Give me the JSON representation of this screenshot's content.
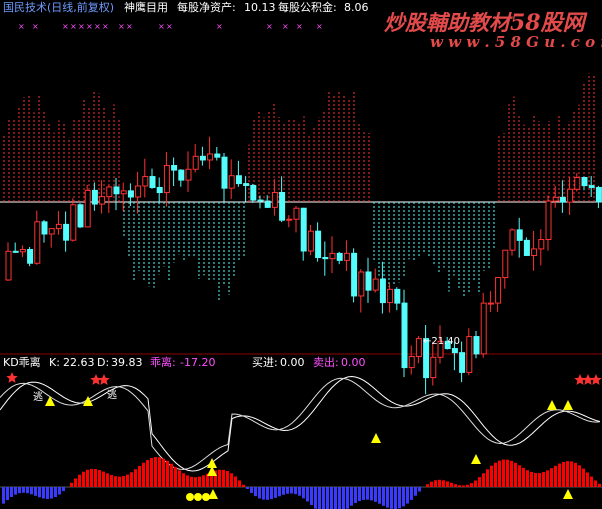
{
  "header": {
    "title": "国民技术(日线,前复权)",
    "indicator_name": "神鹰目用",
    "nav_label": "每股净资产:",
    "nav_value": "10.13",
    "fund_label": "每股公积金:",
    "fund_value": "8.06"
  },
  "watermark": {
    "main": "炒股輔助教材",
    "brand": "58股网",
    "url": "w w w . 5 8 G u . c o m"
  },
  "main_chart": {
    "low_marker": "←21.40"
  },
  "lower_panel": {
    "name": "KD乖离",
    "k_label": "K:",
    "k_value": "22.63",
    "d_label": "D:",
    "d_value": "39.83",
    "deviation_label": "乖离:",
    "deviation_value": "-17.20",
    "buy_label": "买进:",
    "buy_value": "0.00",
    "sell_label": "卖出:",
    "sell_value": "0.00",
    "escape_tag": "逃"
  },
  "colors": {
    "up": "#ff3232",
    "down": "#54fcfc",
    "header_blue": "#6f9bff",
    "header_white": "#ffffff",
    "header_magenta": "#ff50ff",
    "marker_yellow": "#ffff00",
    "deviation_pos": "#ff0000",
    "deviation_neg": "#3b3bff"
  }
}
